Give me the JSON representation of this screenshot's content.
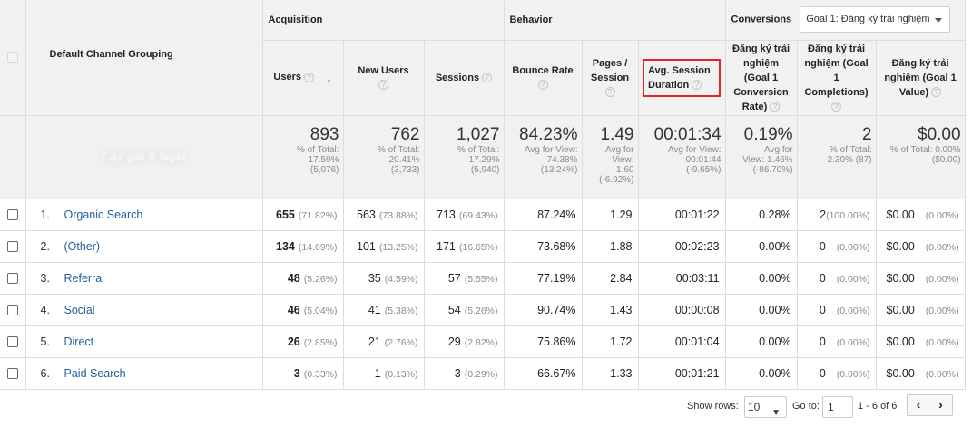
{
  "table": {
    "dimension_header": "Default Channel Grouping",
    "groups": {
      "acquisition": "Acquisition",
      "behavior": "Behavior",
      "conversions": "Conversions"
    },
    "goal_selector": "Goal 1: Đăng ký trải nghiệm",
    "columns": {
      "users": "Users",
      "new_users": "New Users",
      "sessions": "Sessions",
      "bounce_rate": "Bounce Rate",
      "pages_session": "Pages / Session",
      "avg_session_duration": "Avg. Session Duration",
      "goal_conv_rate": "Đăng ký trải nghiệm (Goal 1 Conversion Rate)",
      "goal_completions": "Đăng ký trải nghiệm (Goal 1 Completions)",
      "goal_value": "Đăng ký trải nghiệm (Goal 1 Value)"
    },
    "help_icon": "?",
    "sort_icon": "↓",
    "totals": {
      "label_blurred": "Cậy gắt & Ngắt",
      "users": {
        "value": "893",
        "line1": "% of Total:",
        "line2": "17.59%",
        "line3": "(5,076)"
      },
      "new_users": {
        "value": "762",
        "line1": "% of Total:",
        "line2": "20.41%",
        "line3": "(3,733)"
      },
      "sessions": {
        "value": "1,027",
        "line1": "% of Total:",
        "line2": "17.29%",
        "line3": "(5,940)"
      },
      "bounce_rate": {
        "value": "84.23%",
        "line1": "Avg for View:",
        "line2": "74.38%",
        "line3": "(13.24%)"
      },
      "pages_session": {
        "value": "1.49",
        "line1": "Avg for",
        "line2": "View:",
        "line3": "1.60",
        "line4": "(-6.92%)"
      },
      "avg_session_duration": {
        "value": "00:01:34",
        "line1": "Avg for View:",
        "line2": "00:01:44",
        "line3": "(-9.65%)"
      },
      "goal_conv_rate": {
        "value": "0.19%",
        "line1": "Avg for",
        "line2": "View: 1.46%",
        "line3": "(-86.70%)"
      },
      "goal_completions": {
        "value": "2",
        "line1": "% of Total:",
        "line2": "2.30% (87)"
      },
      "goal_value": {
        "value": "$0.00",
        "line1": "% of Total: 0.00%",
        "line2": "($0.00)"
      }
    },
    "rows": [
      {
        "index": "1.",
        "channel": "Organic Search",
        "users": "655",
        "users_pct": "(71.82%)",
        "new_users": "563",
        "new_users_pct": "(73.88%)",
        "sessions": "713",
        "sessions_pct": "(69.43%)",
        "bounce_rate": "87.24%",
        "pages_session": "1.29",
        "avg_duration": "00:01:22",
        "conv_rate": "0.28%",
        "completions": "2",
        "completions_pct": "(100.00%)",
        "value": "$0.00",
        "value_pct": "(0.00%)"
      },
      {
        "index": "2.",
        "channel": "(Other)",
        "users": "134",
        "users_pct": "(14.69%)",
        "new_users": "101",
        "new_users_pct": "(13.25%)",
        "sessions": "171",
        "sessions_pct": "(16.65%)",
        "bounce_rate": "73.68%",
        "pages_session": "1.88",
        "avg_duration": "00:02:23",
        "conv_rate": "0.00%",
        "completions": "0",
        "completions_pct": "(0.00%)",
        "value": "$0.00",
        "value_pct": "(0.00%)"
      },
      {
        "index": "3.",
        "channel": "Referral",
        "users": "48",
        "users_pct": "(5.26%)",
        "new_users": "35",
        "new_users_pct": "(4.59%)",
        "sessions": "57",
        "sessions_pct": "(5.55%)",
        "bounce_rate": "77.19%",
        "pages_session": "2.84",
        "avg_duration": "00:03:11",
        "conv_rate": "0.00%",
        "completions": "0",
        "completions_pct": "(0.00%)",
        "value": "$0.00",
        "value_pct": "(0.00%)"
      },
      {
        "index": "4.",
        "channel": "Social",
        "users": "46",
        "users_pct": "(5.04%)",
        "new_users": "41",
        "new_users_pct": "(5.38%)",
        "sessions": "54",
        "sessions_pct": "(5.26%)",
        "bounce_rate": "90.74%",
        "pages_session": "1.43",
        "avg_duration": "00:00:08",
        "conv_rate": "0.00%",
        "completions": "0",
        "completions_pct": "(0.00%)",
        "value": "$0.00",
        "value_pct": "(0.00%)"
      },
      {
        "index": "5.",
        "channel": "Direct",
        "users": "26",
        "users_pct": "(2.85%)",
        "new_users": "21",
        "new_users_pct": "(2.76%)",
        "sessions": "29",
        "sessions_pct": "(2.82%)",
        "bounce_rate": "75.86%",
        "pages_session": "1.72",
        "avg_duration": "00:01:04",
        "conv_rate": "0.00%",
        "completions": "0",
        "completions_pct": "(0.00%)",
        "value": "$0.00",
        "value_pct": "(0.00%)"
      },
      {
        "index": "6.",
        "channel": "Paid Search",
        "users": "3",
        "users_pct": "(0.33%)",
        "new_users": "1",
        "new_users_pct": "(0.13%)",
        "sessions": "3",
        "sessions_pct": "(0.29%)",
        "bounce_rate": "66.67%",
        "pages_session": "1.33",
        "avg_duration": "00:01:21",
        "conv_rate": "0.00%",
        "completions": "0",
        "completions_pct": "(0.00%)",
        "value": "$0.00",
        "value_pct": "(0.00%)"
      }
    ]
  },
  "pagination": {
    "show_rows_label": "Show rows:",
    "rows_value": "10",
    "goto_label": "Go to:",
    "goto_value": "1",
    "range_text": "1 - 6 of 6",
    "prev_glyph": "‹",
    "next_glyph": "›"
  },
  "colors": {
    "link": "#1f5f9a",
    "highlight_border": "#e0262b",
    "header_bg": "#f1f1f1"
  }
}
